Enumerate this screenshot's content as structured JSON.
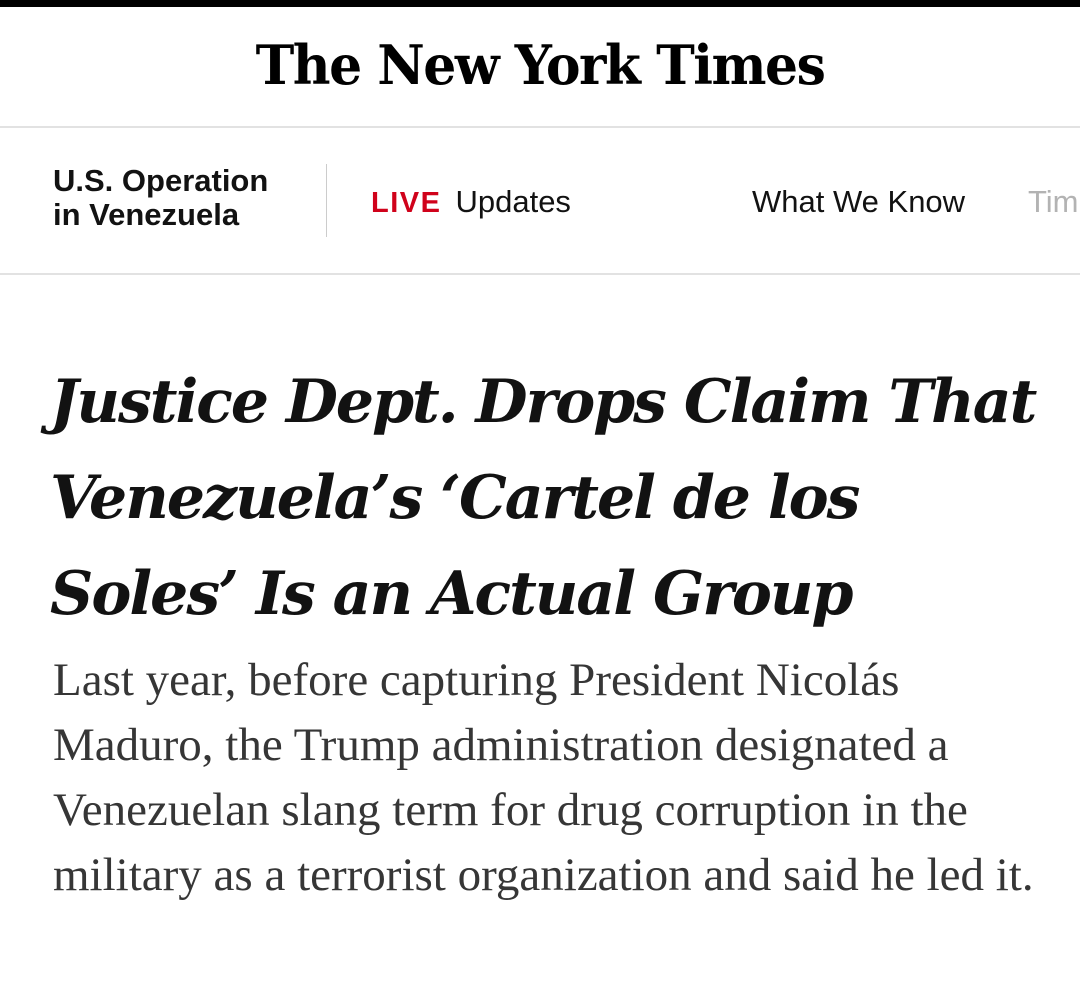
{
  "masthead": {
    "logo_text": "The New York Times"
  },
  "subnav": {
    "section_title_line1": "U.S. Operation",
    "section_title_line2": "in Venezuela",
    "live_badge": "LIVE",
    "live_label": "Updates",
    "what_we_know": "What We Know",
    "timeline_partial": "Tim",
    "live_color": "#d0021b"
  },
  "article": {
    "headline": "Justice Dept. Drops Claim That Venezuela’s ‘Cartel de los Soles’ Is an Actual Group",
    "summary": "Last year, before capturing President Nicolás Maduro, the Trump administration designated a Venezuelan slang term for drug corruption in the military as a terrorist organization and said he led it."
  }
}
